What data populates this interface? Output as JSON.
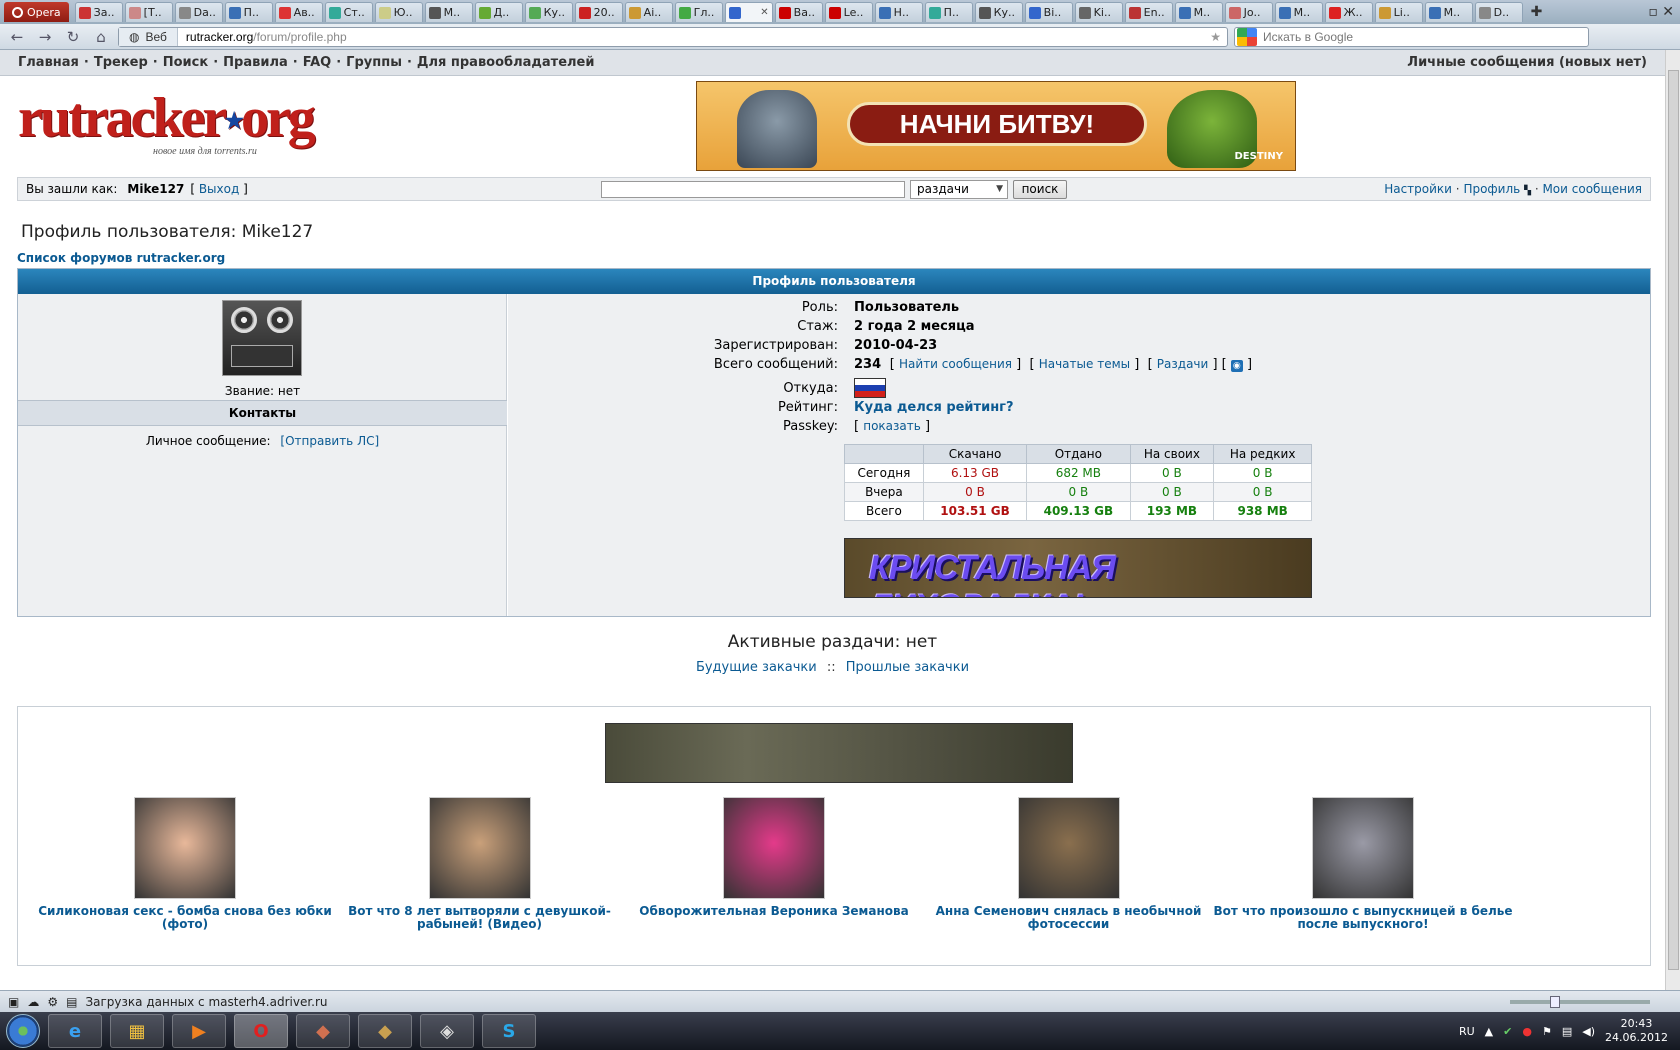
{
  "browser": {
    "opera_label": "Opera",
    "tabs": [
      "За..",
      "[Т..",
      "Da..",
      "П..",
      "Ав..",
      "Ст..",
      "Ю..",
      "М..",
      "Д..",
      "Ку..",
      "20..",
      "Ai..",
      "Гл..",
      "",
      "Ва..",
      "Le..",
      "Н..",
      "П..",
      "Ку..",
      "Bi..",
      "Ki..",
      "En..",
      "М..",
      "Jo..",
      "М..",
      "Ж..",
      "Li..",
      "М..",
      "D.."
    ],
    "active_tab_index": 13,
    "url_badge": "Веб",
    "url_host": "rutracker.org",
    "url_path": "/forum/profile.php",
    "search_placeholder": "Искать в Google"
  },
  "nav": {
    "items": [
      "Главная",
      "Трекер",
      "Поиск",
      "Правила",
      "FAQ",
      "Группы",
      "Для правообладателей"
    ],
    "pm_link": "Личные сообщения (новых нет)"
  },
  "logo": {
    "text_a": "rutracker",
    "text_b": "org",
    "subtitle": "новое имя для torrents.ru"
  },
  "banner_top": {
    "text": "НАЧНИ БИТВУ!",
    "brand": "DESTINY"
  },
  "login": {
    "prefix": "Вы зашли как:",
    "username": "Mike127",
    "logout": "Выход",
    "search_option": "раздачи",
    "search_button": "поиск",
    "links": [
      "Настройки",
      "Профиль",
      "Мои сообщения"
    ]
  },
  "page_title": "Профиль пользователя: Mike127",
  "forum_link": "Список форумов rutracker.org",
  "profile": {
    "header": "Профиль пользователя",
    "rank": "Звание: нет",
    "contacts_title": "Контакты",
    "pm_label": "Личное сообщение:",
    "pm_link": "[Отправить ЛС]",
    "fields": {
      "role_label": "Роль:",
      "role": "Пользователь",
      "tenure_label": "Стаж:",
      "tenure": "2 года 2 месяца",
      "registered_label": "Зарегистрирован:",
      "registered": "2010-04-23",
      "posts_label": "Всего сообщений:",
      "posts": "234",
      "find_posts": "Найти сообщения",
      "started_topics": "Начатые темы",
      "releases": "Раздачи",
      "from_label": "Откуда:",
      "rating_label": "Рейтинг:",
      "rating_link": "Куда делся рейтинг?",
      "passkey_label": "Passkey:",
      "passkey_link": "показать"
    },
    "stats": {
      "headers": [
        "",
        "Скачано",
        "Отдано",
        "На своих",
        "На редких"
      ],
      "rows": [
        {
          "label": "Сегодня",
          "downloaded": "6.13 GB",
          "uploaded": "682 MB",
          "own": "0 B",
          "rare": "0 B"
        },
        {
          "label": "Вчера",
          "downloaded": "0 B",
          "uploaded": "0 B",
          "own": "0 B",
          "rare": "0 B"
        },
        {
          "label": "Всего",
          "downloaded": "103.51 GB",
          "uploaded": "409.13 GB",
          "own": "193 MB",
          "rare": "938 MB"
        }
      ]
    },
    "banner_text": "КРИСТАЛЬНАЯ ЛИХОРАДКА!"
  },
  "active_releases": "Активные раздачи: нет",
  "downloads": {
    "future": "Будущие закачки",
    "sep": "::",
    "past": "Прошлые закачки"
  },
  "teasers": [
    {
      "caption": "Силиконовая секс - бомба снова без юбки (фото)",
      "color": "#e8b89a"
    },
    {
      "caption": "Вот что 8 лет вытворяли с девушкой- рабыней! (Видео)",
      "color": "#c9a07a"
    },
    {
      "caption": "Обворожительная Вероника Земанова",
      "color": "#e43a8a"
    },
    {
      "caption": "Анна Семенович снялась в необычной фотосессии",
      "color": "#8a6f4e"
    },
    {
      "caption": "Вот что произошло с выпускницей в белье после выпускного!",
      "color": "#9a9aa6"
    }
  ],
  "status": {
    "text": "Загрузка данных с masterh4.adriver.ru"
  },
  "taskbar": {
    "lang": "RU",
    "time": "20:43",
    "date": "24.06.2012"
  }
}
